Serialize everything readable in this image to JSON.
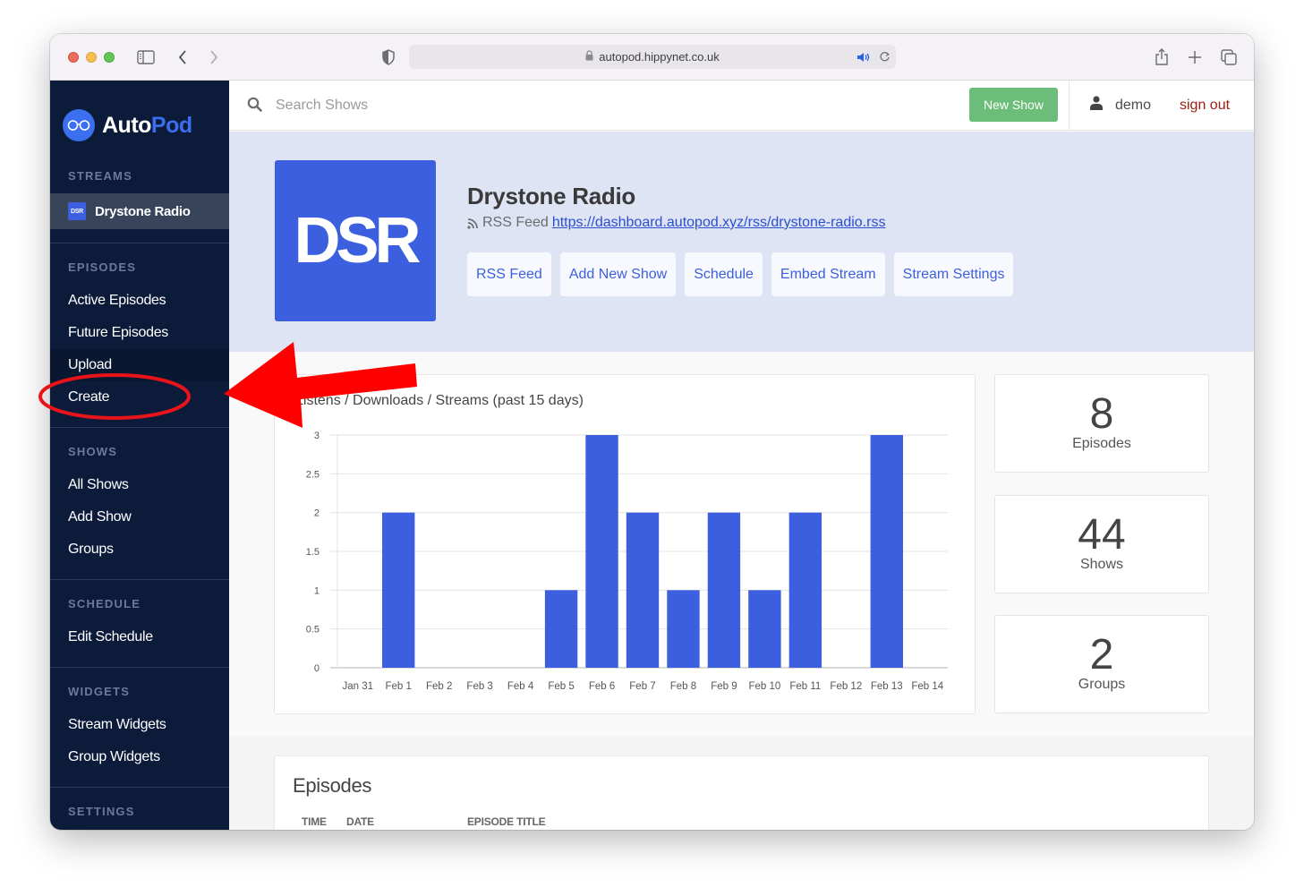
{
  "browser": {
    "url": "autopod.hippynet.co.uk",
    "icons": [
      "sidebar-toggle-icon",
      "back-icon",
      "forward-icon",
      "privacy-shield-icon",
      "lock-icon",
      "speaker-icon",
      "reload-icon",
      "share-icon",
      "new-tab-icon",
      "tabs-overview-icon"
    ]
  },
  "brand": {
    "name_part1": "Auto",
    "name_part2": "Pod",
    "accent": "#3b6ff0"
  },
  "sidebar": {
    "sections": [
      {
        "title": "STREAMS",
        "items": [
          {
            "label": "Drystone Radio",
            "badge": "DSR",
            "active": true
          }
        ]
      },
      {
        "title": "EPISODES",
        "items": [
          {
            "label": "Active Episodes"
          },
          {
            "label": "Future Episodes"
          },
          {
            "label": "Upload"
          },
          {
            "label": "Create"
          }
        ]
      },
      {
        "title": "SHOWS",
        "items": [
          {
            "label": "All Shows"
          },
          {
            "label": "Add Show"
          },
          {
            "label": "Groups"
          }
        ]
      },
      {
        "title": "SCHEDULE",
        "items": [
          {
            "label": "Edit Schedule"
          }
        ]
      },
      {
        "title": "WIDGETS",
        "items": [
          {
            "label": "Stream Widgets"
          },
          {
            "label": "Group Widgets"
          }
        ]
      },
      {
        "title": "SETTINGS",
        "items": []
      }
    ]
  },
  "header": {
    "search_placeholder": "Search Shows",
    "new_show_label": "New Show",
    "username": "demo",
    "signout_label": "sign out"
  },
  "stream": {
    "art_text": "DSR",
    "title": "Drystone Radio",
    "rss_label": "RSS Feed",
    "rss_url": "https://dashboard.autopod.xyz/rss/drystone-radio.rss",
    "buttons": [
      "RSS Feed",
      "Add New Show",
      "Schedule",
      "Embed Stream",
      "Stream Settings"
    ]
  },
  "stats": [
    {
      "value": "8",
      "label": "Episodes"
    },
    {
      "value": "44",
      "label": "Shows"
    },
    {
      "value": "2",
      "label": "Groups"
    }
  ],
  "episodes": {
    "title": "Episodes",
    "columns": [
      "TIME",
      "DATE",
      "EPISODE TITLE"
    ]
  },
  "annotation": {
    "note": "Red arrow and circle highlighting the Create menu item",
    "color": "#ff0000"
  },
  "chart_data": {
    "type": "bar",
    "title": "Listens / Downloads / Streams (past 15 days)",
    "categories": [
      "Jan 31",
      "Feb 1",
      "Feb 2",
      "Feb 3",
      "Feb 4",
      "Feb 5",
      "Feb 6",
      "Feb 7",
      "Feb 8",
      "Feb 9",
      "Feb 10",
      "Feb 11",
      "Feb 12",
      "Feb 13",
      "Feb 14"
    ],
    "values": [
      0,
      2,
      0,
      0,
      0,
      1,
      3,
      2,
      1,
      2,
      1,
      2,
      0,
      3,
      0
    ],
    "yticks": [
      "0",
      "0.5",
      "1",
      "1.5",
      "2",
      "2.5",
      "3"
    ],
    "ylim": [
      0,
      3
    ],
    "xlabel": "",
    "ylabel": "",
    "grid": true,
    "bar_color": "#3b5fde"
  }
}
